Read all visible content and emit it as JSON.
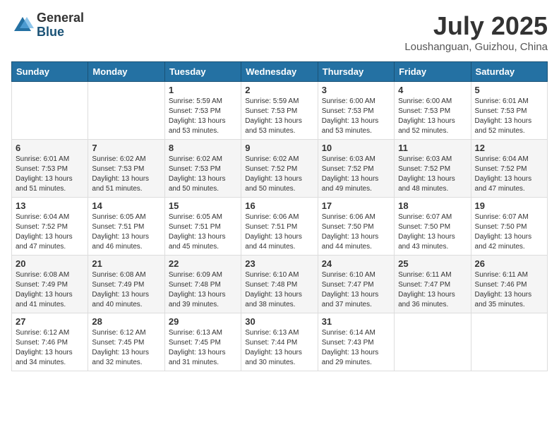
{
  "logo": {
    "general": "General",
    "blue": "Blue"
  },
  "title": "July 2025",
  "location": "Loushanguan, Guizhou, China",
  "weekdays": [
    "Sunday",
    "Monday",
    "Tuesday",
    "Wednesday",
    "Thursday",
    "Friday",
    "Saturday"
  ],
  "weeks": [
    [
      {
        "day": "",
        "detail": ""
      },
      {
        "day": "",
        "detail": ""
      },
      {
        "day": "1",
        "detail": "Sunrise: 5:59 AM\nSunset: 7:53 PM\nDaylight: 13 hours and 53 minutes."
      },
      {
        "day": "2",
        "detail": "Sunrise: 5:59 AM\nSunset: 7:53 PM\nDaylight: 13 hours and 53 minutes."
      },
      {
        "day": "3",
        "detail": "Sunrise: 6:00 AM\nSunset: 7:53 PM\nDaylight: 13 hours and 53 minutes."
      },
      {
        "day": "4",
        "detail": "Sunrise: 6:00 AM\nSunset: 7:53 PM\nDaylight: 13 hours and 52 minutes."
      },
      {
        "day": "5",
        "detail": "Sunrise: 6:01 AM\nSunset: 7:53 PM\nDaylight: 13 hours and 52 minutes."
      }
    ],
    [
      {
        "day": "6",
        "detail": "Sunrise: 6:01 AM\nSunset: 7:53 PM\nDaylight: 13 hours and 51 minutes."
      },
      {
        "day": "7",
        "detail": "Sunrise: 6:02 AM\nSunset: 7:53 PM\nDaylight: 13 hours and 51 minutes."
      },
      {
        "day": "8",
        "detail": "Sunrise: 6:02 AM\nSunset: 7:53 PM\nDaylight: 13 hours and 50 minutes."
      },
      {
        "day": "9",
        "detail": "Sunrise: 6:02 AM\nSunset: 7:52 PM\nDaylight: 13 hours and 50 minutes."
      },
      {
        "day": "10",
        "detail": "Sunrise: 6:03 AM\nSunset: 7:52 PM\nDaylight: 13 hours and 49 minutes."
      },
      {
        "day": "11",
        "detail": "Sunrise: 6:03 AM\nSunset: 7:52 PM\nDaylight: 13 hours and 48 minutes."
      },
      {
        "day": "12",
        "detail": "Sunrise: 6:04 AM\nSunset: 7:52 PM\nDaylight: 13 hours and 47 minutes."
      }
    ],
    [
      {
        "day": "13",
        "detail": "Sunrise: 6:04 AM\nSunset: 7:52 PM\nDaylight: 13 hours and 47 minutes."
      },
      {
        "day": "14",
        "detail": "Sunrise: 6:05 AM\nSunset: 7:51 PM\nDaylight: 13 hours and 46 minutes."
      },
      {
        "day": "15",
        "detail": "Sunrise: 6:05 AM\nSunset: 7:51 PM\nDaylight: 13 hours and 45 minutes."
      },
      {
        "day": "16",
        "detail": "Sunrise: 6:06 AM\nSunset: 7:51 PM\nDaylight: 13 hours and 44 minutes."
      },
      {
        "day": "17",
        "detail": "Sunrise: 6:06 AM\nSunset: 7:50 PM\nDaylight: 13 hours and 44 minutes."
      },
      {
        "day": "18",
        "detail": "Sunrise: 6:07 AM\nSunset: 7:50 PM\nDaylight: 13 hours and 43 minutes."
      },
      {
        "day": "19",
        "detail": "Sunrise: 6:07 AM\nSunset: 7:50 PM\nDaylight: 13 hours and 42 minutes."
      }
    ],
    [
      {
        "day": "20",
        "detail": "Sunrise: 6:08 AM\nSunset: 7:49 PM\nDaylight: 13 hours and 41 minutes."
      },
      {
        "day": "21",
        "detail": "Sunrise: 6:08 AM\nSunset: 7:49 PM\nDaylight: 13 hours and 40 minutes."
      },
      {
        "day": "22",
        "detail": "Sunrise: 6:09 AM\nSunset: 7:48 PM\nDaylight: 13 hours and 39 minutes."
      },
      {
        "day": "23",
        "detail": "Sunrise: 6:10 AM\nSunset: 7:48 PM\nDaylight: 13 hours and 38 minutes."
      },
      {
        "day": "24",
        "detail": "Sunrise: 6:10 AM\nSunset: 7:47 PM\nDaylight: 13 hours and 37 minutes."
      },
      {
        "day": "25",
        "detail": "Sunrise: 6:11 AM\nSunset: 7:47 PM\nDaylight: 13 hours and 36 minutes."
      },
      {
        "day": "26",
        "detail": "Sunrise: 6:11 AM\nSunset: 7:46 PM\nDaylight: 13 hours and 35 minutes."
      }
    ],
    [
      {
        "day": "27",
        "detail": "Sunrise: 6:12 AM\nSunset: 7:46 PM\nDaylight: 13 hours and 34 minutes."
      },
      {
        "day": "28",
        "detail": "Sunrise: 6:12 AM\nSunset: 7:45 PM\nDaylight: 13 hours and 32 minutes."
      },
      {
        "day": "29",
        "detail": "Sunrise: 6:13 AM\nSunset: 7:45 PM\nDaylight: 13 hours and 31 minutes."
      },
      {
        "day": "30",
        "detail": "Sunrise: 6:13 AM\nSunset: 7:44 PM\nDaylight: 13 hours and 30 minutes."
      },
      {
        "day": "31",
        "detail": "Sunrise: 6:14 AM\nSunset: 7:43 PM\nDaylight: 13 hours and 29 minutes."
      },
      {
        "day": "",
        "detail": ""
      },
      {
        "day": "",
        "detail": ""
      }
    ]
  ]
}
